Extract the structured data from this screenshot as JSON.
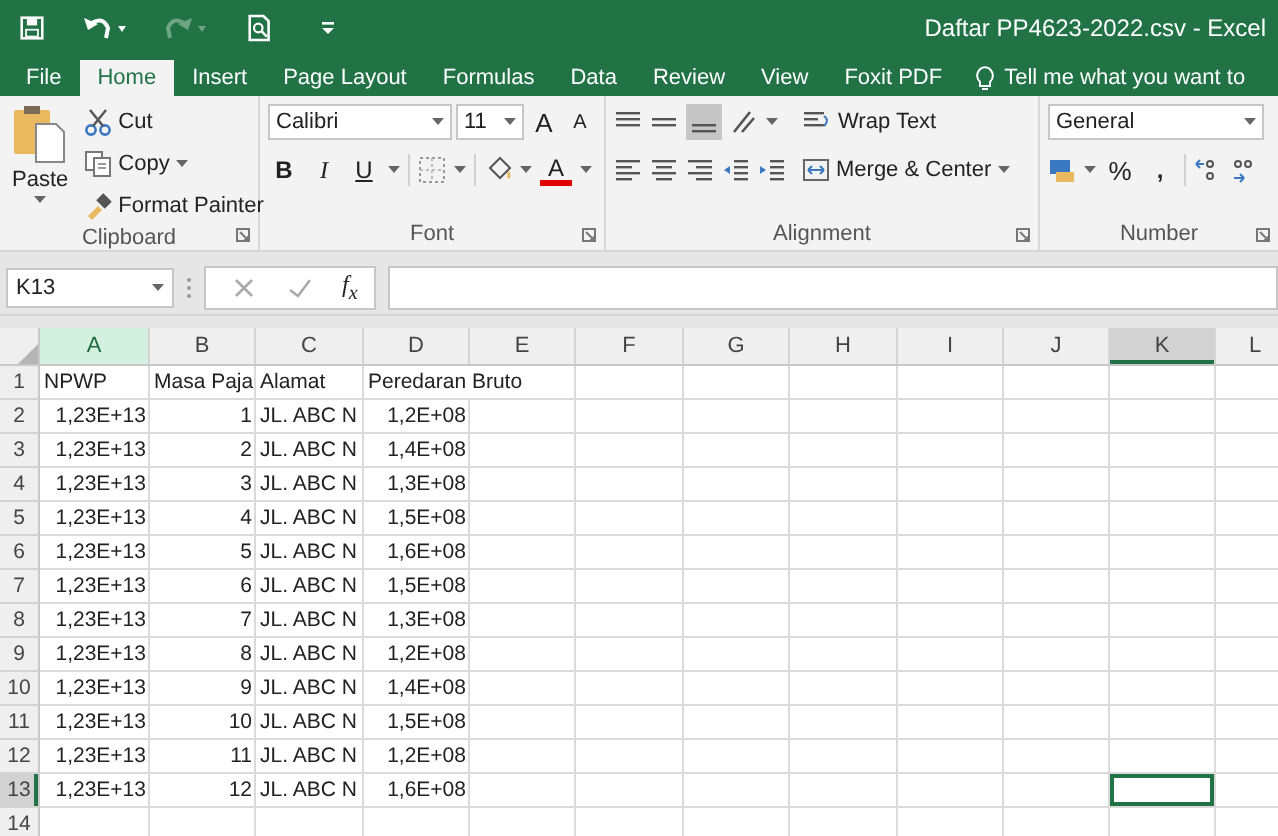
{
  "window": {
    "title": "Daftar PP4623-2022.csv - Excel"
  },
  "quick_access": [
    {
      "kind": "save",
      "disabled": false
    },
    {
      "kind": "undo",
      "disabled": false
    },
    {
      "kind": "redo",
      "disabled": true
    },
    {
      "kind": "preview",
      "disabled": false
    },
    {
      "kind": "customize",
      "disabled": false
    }
  ],
  "tabs": [
    {
      "label": "File",
      "selected": false
    },
    {
      "label": "Home",
      "selected": true
    },
    {
      "label": "Insert",
      "selected": false
    },
    {
      "label": "Page Layout",
      "selected": false
    },
    {
      "label": "Formulas",
      "selected": false
    },
    {
      "label": "Data",
      "selected": false
    },
    {
      "label": "Review",
      "selected": false
    },
    {
      "label": "View",
      "selected": false
    },
    {
      "label": "Foxit PDF",
      "selected": false
    }
  ],
  "tell_me": "Tell me what you want to",
  "clipboard": {
    "label": "Clipboard",
    "paste": "Paste",
    "cut": "Cut",
    "copy": "Copy",
    "format_painter": "Format Painter"
  },
  "font": {
    "label": "Font",
    "font_name": "Calibri",
    "font_size": "11",
    "grow": "A",
    "shrink": "A",
    "bold": "B",
    "italic": "I",
    "underline": "U",
    "font_color": "A"
  },
  "alignment": {
    "label": "Alignment",
    "wrap_text": "Wrap Text",
    "merge_center": "Merge & Center"
  },
  "number": {
    "label": "Number",
    "format": "General",
    "percent": "%",
    "comma": ","
  },
  "formula_bar": {
    "name_box": "K13",
    "fx": "f$_{x}$"
  },
  "columns": [
    {
      "label": "A",
      "numeric": true,
      "highlighted": true,
      "selected": false
    },
    {
      "label": "B",
      "numeric": true,
      "highlighted": false,
      "selected": false
    },
    {
      "label": "C",
      "numeric": false,
      "highlighted": false,
      "selected": false
    },
    {
      "label": "D",
      "numeric": true,
      "highlighted": false,
      "selected": false
    },
    {
      "label": "E",
      "highlighted": false,
      "selected": false
    },
    {
      "label": "F",
      "highlighted": false,
      "selected": false
    },
    {
      "label": "G",
      "highlighted": false,
      "selected": false
    },
    {
      "label": "H",
      "highlighted": false,
      "selected": false
    },
    {
      "label": "I",
      "highlighted": false,
      "selected": false
    },
    {
      "label": "J",
      "highlighted": false,
      "selected": false
    },
    {
      "label": "K",
      "highlighted": false,
      "selected": true
    },
    {
      "label": "L",
      "highlighted": false,
      "selected": false
    }
  ],
  "rows": [
    {
      "label": "1",
      "kind": "labels",
      "selected": false,
      "cells": [
        "NPWP",
        "Masa Paja",
        "Alamat",
        "Peredaran Bruto"
      ]
    },
    {
      "label": "2",
      "kind": "data",
      "selected": false,
      "cells": [
        "1,23E+13",
        "1",
        "JL. ABC N",
        "1,2E+08"
      ]
    },
    {
      "label": "3",
      "kind": "data",
      "selected": false,
      "cells": [
        "1,23E+13",
        "2",
        "JL. ABC N",
        "1,4E+08"
      ]
    },
    {
      "label": "4",
      "kind": "data",
      "selected": false,
      "cells": [
        "1,23E+13",
        "3",
        "JL. ABC N",
        "1,3E+08"
      ]
    },
    {
      "label": "5",
      "kind": "data",
      "selected": false,
      "cells": [
        "1,23E+13",
        "4",
        "JL. ABC N",
        "1,5E+08"
      ]
    },
    {
      "label": "6",
      "kind": "data",
      "selected": false,
      "cells": [
        "1,23E+13",
        "5",
        "JL. ABC N",
        "1,6E+08"
      ]
    },
    {
      "label": "7",
      "kind": "data",
      "selected": false,
      "cells": [
        "1,23E+13",
        "6",
        "JL. ABC N",
        "1,5E+08"
      ]
    },
    {
      "label": "8",
      "kind": "data",
      "selected": false,
      "cells": [
        "1,23E+13",
        "7",
        "JL. ABC N",
        "1,3E+08"
      ]
    },
    {
      "label": "9",
      "kind": "data",
      "selected": false,
      "cells": [
        "1,23E+13",
        "8",
        "JL. ABC N",
        "1,2E+08"
      ]
    },
    {
      "label": "10",
      "kind": "data",
      "selected": false,
      "cells": [
        "1,23E+13",
        "9",
        "JL. ABC N",
        "1,4E+08"
      ]
    },
    {
      "label": "11",
      "kind": "data",
      "selected": false,
      "cells": [
        "1,23E+13",
        "10",
        "JL. ABC N",
        "1,5E+08"
      ]
    },
    {
      "label": "12",
      "kind": "data",
      "selected": false,
      "cells": [
        "1,23E+13",
        "11",
        "JL. ABC N",
        "1,2E+08"
      ]
    },
    {
      "label": "13",
      "kind": "data",
      "selected": true,
      "cells": [
        "1,23E+13",
        "12",
        "JL. ABC N",
        "1,6E+08"
      ]
    },
    {
      "label": "14",
      "selected": false
    }
  ]
}
